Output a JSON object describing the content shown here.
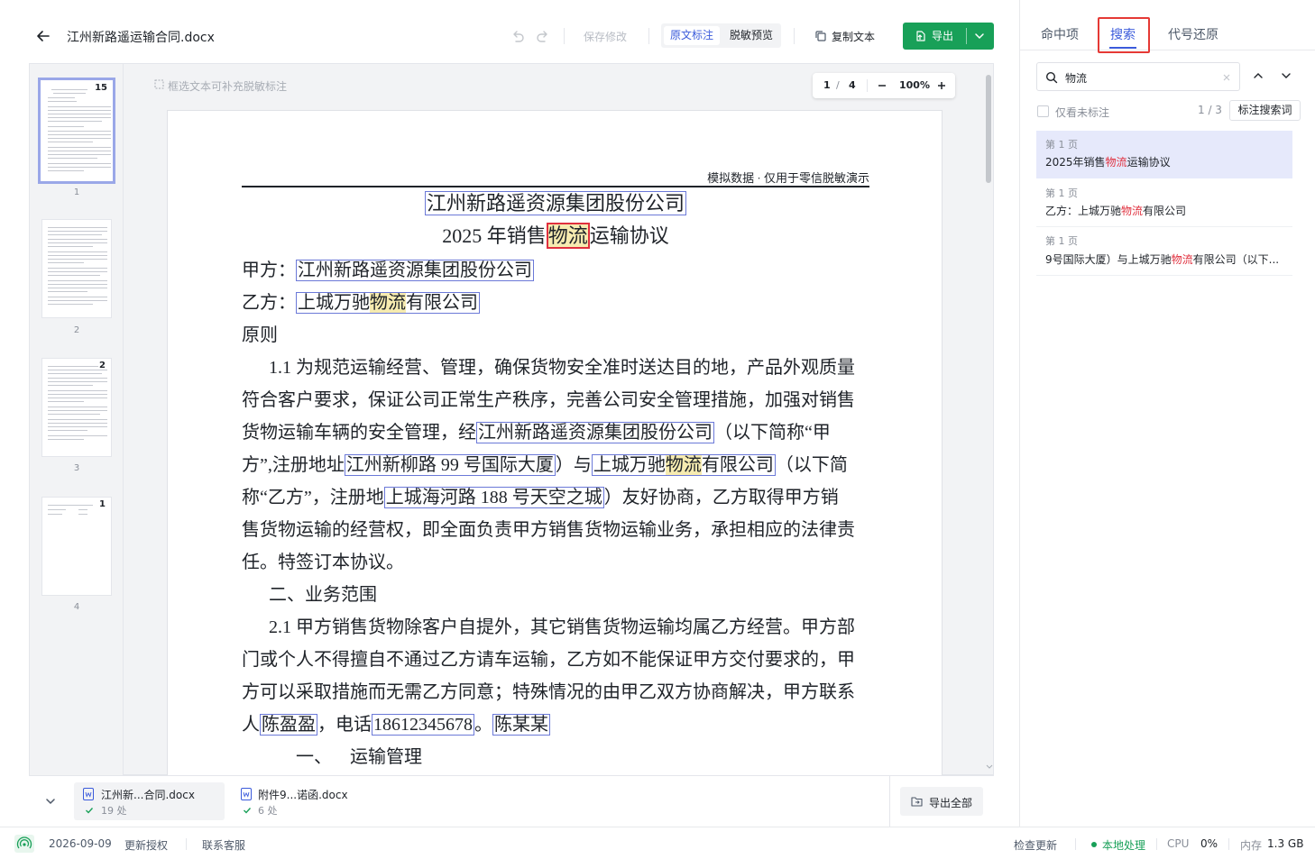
{
  "toolbar": {
    "file_title": "江州新路遥运输合同.docx",
    "save_changes": "保存修改",
    "mode_original": "原文标注",
    "mode_preview": "脱敏预览",
    "copy_text": "复制文本",
    "export": "导出"
  },
  "viewer": {
    "hint": "框选文本可补充脱敏标注",
    "current_page": "1",
    "page_sep": "/",
    "total_pages": "4",
    "zoom": "100%"
  },
  "thumbnails": [
    {
      "number": "1",
      "badge": "15",
      "selected": true
    },
    {
      "number": "2",
      "badge": "",
      "selected": false
    },
    {
      "number": "3",
      "badge": "2",
      "selected": false
    },
    {
      "number": "4",
      "badge": "1",
      "selected": false
    }
  ],
  "document": {
    "header_note": "模拟数据 · 仅用于零信脱敏演示",
    "company": "江州新路遥资源集团股份公司",
    "title_pre": "2025 年销售",
    "title_kw": "物流",
    "title_post": "运输协议",
    "party_a_label": "甲方：",
    "party_a": "江州新路遥资源集团股份公司",
    "party_b_label": "乙方：",
    "party_b_pre": "上城万驰",
    "party_b_kw": "物流",
    "party_b_post": "有限公司",
    "principle": "原则",
    "p1_l1": "1.1 为规范运输经营、管理，确保货物安全准时送达目的地，产品外观质量",
    "p1_l2": "符合客户要求，保证公司正常生产秩序，完善公司安全管理措施，加强对销售",
    "p1_l3_pre": "货物运输车辆的安全管理，经",
    "p1_l3_company": "江州新路遥资源集团股份公司",
    "p1_l3_post": "（以下简称“甲",
    "p1_l4_pre": "方”,注册地址",
    "p1_l4_addr": "江州新柳路 99 号国际大厦",
    "p1_l4_mid": "）与",
    "p1_l4_co_pre": "上城万驰",
    "p1_l4_co_kw": "物流",
    "p1_l4_co_post": "有限公司",
    "p1_l4_post": "（以下简",
    "p1_l5_pre": "称“乙方”，注册地",
    "p1_l5_addr": "上城海河路 188 号天空之城",
    "p1_l5_post": "）友好协商，乙方取得甲方销",
    "p1_l6": "售货物运输的经营权，即全面负责甲方销售货物运输业务，承担相应的法律责",
    "p1_l7": "任。特签订本协议。",
    "sec2": "二、业务范围",
    "p2_l1": "2.1 甲方销售货物除客户自提外，其它销售货物运输均属乙方经营。甲方部",
    "p2_l2": "门或个人不得擅自不通过乙方请车运输，乙方如不能保证甲方交付要求的，甲",
    "p2_l3": "方可以采取措施而无需乙方同意；特殊情况的由甲乙双方协商解决，甲方联系",
    "p2_l4_pre": "人",
    "p2_l4_name": "陈盈盈",
    "p2_l4_mid": "，电话",
    "p2_l4_phone": "18612345678",
    "p2_l4_sep": "。",
    "p2_l4_name2": "陈某某",
    "sec3_num": "一、",
    "sec3": "运输管理"
  },
  "files": [
    {
      "name": "江州新...合同.docx",
      "count": "19 处",
      "active": true
    },
    {
      "name": "附件9...诺函.docx",
      "count": "6 处",
      "active": false
    }
  ],
  "export_all": "导出全部",
  "right_panel": {
    "tabs": [
      "命中项",
      "搜索",
      "代号还原"
    ],
    "active_tab": 1,
    "search_value": "物流",
    "only_unmarked": "仅看未标注",
    "result_counter": "1 / 3",
    "mark_terms": "标注搜索词",
    "results": [
      {
        "page": "第 1 页",
        "pre": "2025年销售",
        "kw": "物流",
        "post": "运输协议"
      },
      {
        "page": "第 1 页",
        "pre": "乙方：上城万驰",
        "kw": "物流",
        "post": "有限公司"
      },
      {
        "page": "第 1 页",
        "pre": "9号国际大厦）与上城万驰",
        "kw": "物流",
        "post": "有限公司（以下..."
      }
    ]
  },
  "statusbar": {
    "date": "2026-09-09",
    "renew": "更新授权",
    "support": "联系客服",
    "check_update": "检查更新",
    "local": "本地处理",
    "cpu_label": "CPU",
    "cpu_value": "0%",
    "mem_label": "内存",
    "mem_value": "1.3 GB"
  },
  "colors": {
    "accent": "#3b5bdb",
    "export_green": "#18a058",
    "highlight_red": "#e53935",
    "mark_border": "#6b79d8"
  }
}
